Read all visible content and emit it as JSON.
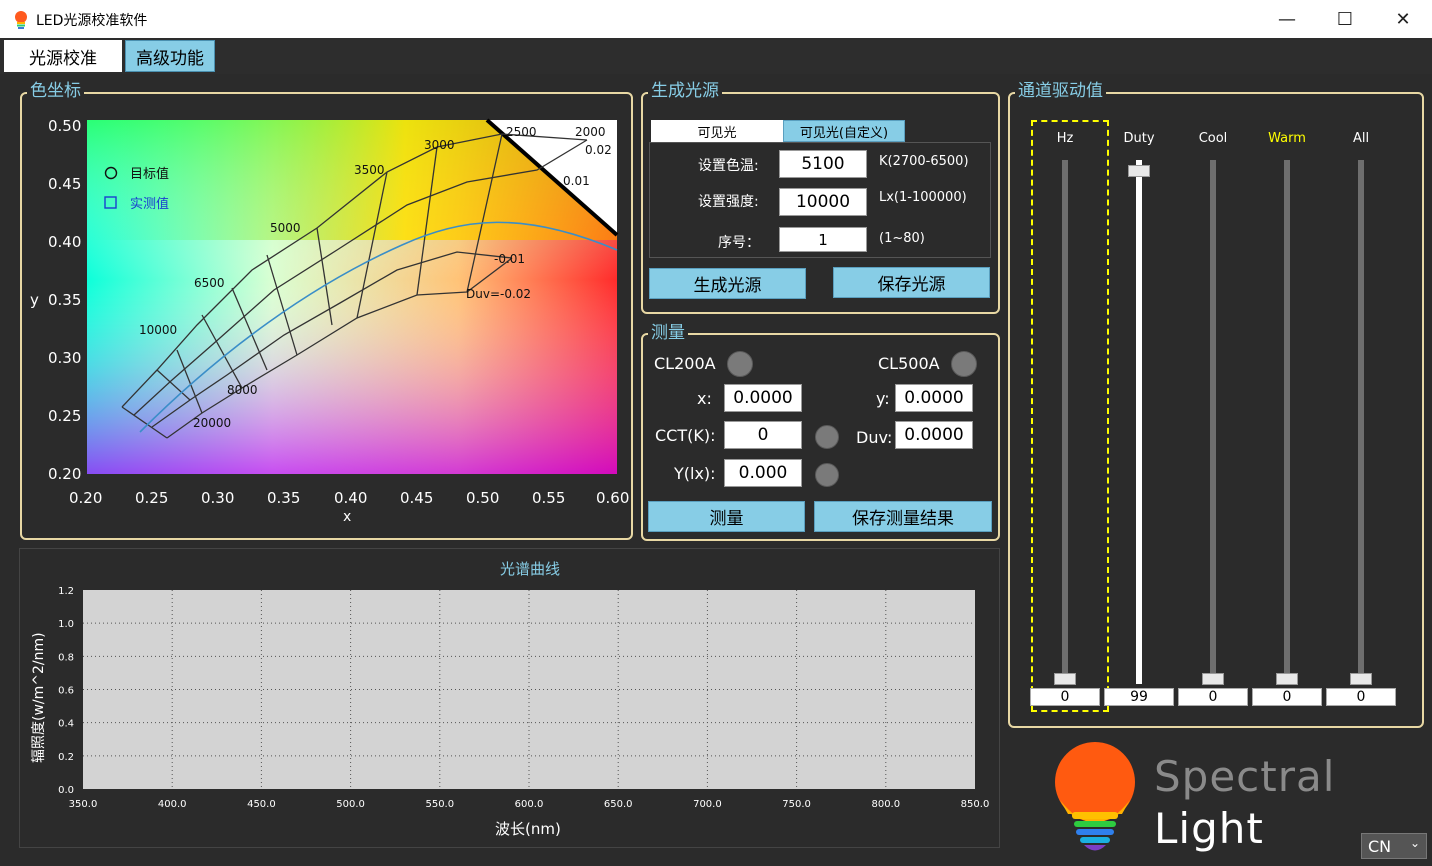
{
  "window": {
    "title": "LED光源校准软件",
    "minimize_glyph": "—",
    "maximize_glyph": "☐",
    "close_glyph": "✕"
  },
  "tabs": [
    {
      "label": "光源校准",
      "active": false
    },
    {
      "label": "高级功能",
      "active": true
    }
  ],
  "chromaticity": {
    "group_title": "色坐标",
    "legend_target": "目标值",
    "legend_measured": "实测值",
    "x_label": "x",
    "y_label": "y",
    "x_ticks": [
      "0.20",
      "0.25",
      "0.30",
      "0.35",
      "0.40",
      "0.45",
      "0.50",
      "0.55",
      "0.60"
    ],
    "y_ticks": [
      "0.50",
      "0.45",
      "0.40",
      "0.35",
      "0.30",
      "0.25",
      "0.20"
    ],
    "cct_labels": [
      "2000",
      "2500",
      "3000",
      "3500",
      "5000",
      "6500",
      "10000",
      "8000",
      "20000"
    ],
    "duv_labels": [
      "0.02",
      "0.01",
      "-0.01",
      "Duv=-0.02"
    ]
  },
  "generate": {
    "group_title": "生成光源",
    "subtab_visible": "可见光",
    "subtab_custom": "可见光(自定义)",
    "cct_label": "设置色温:",
    "cct_value": "5100",
    "cct_range": "K(2700-6500)",
    "intensity_label": "设置强度:",
    "intensity_value": "10000",
    "intensity_range": "Lx(1-100000)",
    "index_label": "序号：",
    "index_value": "1",
    "index_range": "(1~80)",
    "generate_button": "生成光源",
    "save_button": "保存光源"
  },
  "measure": {
    "group_title": "测量",
    "cl200a_label": "CL200A",
    "cl500a_label": "CL500A",
    "x_label": "x:",
    "x_value": "0.0000",
    "y_label": "y:",
    "y_value": "0.0000",
    "cct_label": "CCT(K):",
    "cct_value": "0",
    "duv_label": "Duv:",
    "duv_value": "0.0000",
    "lux_label": "Y(lx):",
    "lux_value": "0.000",
    "measure_button": "测量",
    "save_button": "保存测量结果"
  },
  "channels": {
    "group_title": "通道驱动值",
    "items": [
      {
        "label": "Hz",
        "value": "0",
        "level": 0,
        "color": "#ffffff"
      },
      {
        "label": "Duty",
        "value": "99",
        "level": 0.99,
        "color": "#ffffff"
      },
      {
        "label": "Cool",
        "value": "0",
        "level": 0,
        "color": "#ffffff"
      },
      {
        "label": "Warm",
        "value": "0",
        "level": 0,
        "color": "#ffff00"
      },
      {
        "label": "All",
        "value": "0",
        "level": 0,
        "color": "#ffffff"
      }
    ]
  },
  "spectrum": {
    "title": "光谱曲线",
    "x_label": "波长(nm)",
    "y_label": "辐照度(w/m^2/nm)",
    "x_ticks": [
      "350.0",
      "400.0",
      "450.0",
      "500.0",
      "550.0",
      "600.0",
      "650.0",
      "700.0",
      "750.0",
      "800.0",
      "850.0"
    ],
    "y_ticks": [
      "1.2",
      "1.0",
      "0.8",
      "0.6",
      "0.4",
      "0.2",
      "0.0"
    ]
  },
  "chart_data": {
    "type": "line",
    "x": [],
    "series": [],
    "xlabel": "波长(nm)",
    "ylabel": "辐照度(w/m^2/nm)",
    "xlim": [
      350,
      850
    ],
    "ylim": [
      0,
      1.2
    ],
    "title": "光谱曲线",
    "grid": true
  },
  "brand": {
    "line1": "Spectral",
    "line2": "Light"
  },
  "language": {
    "value": "CN"
  },
  "colors": {
    "accent": "#87cde6",
    "panel_bg": "#2b2b2b",
    "group_border": "#e8d8a4",
    "highlight": "#ffff00"
  }
}
